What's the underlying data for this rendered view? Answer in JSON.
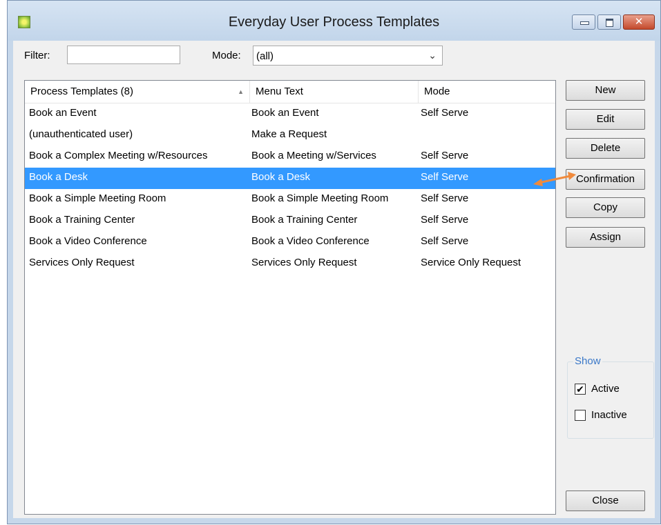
{
  "window": {
    "title": "Everyday User Process Templates"
  },
  "filter": {
    "label": "Filter:",
    "value": ""
  },
  "mode": {
    "label": "Mode:",
    "selected": "(all)"
  },
  "list": {
    "columns": [
      "Process Templates (8)",
      "Menu Text",
      "Mode"
    ],
    "rows": [
      [
        "Book an Event",
        "Book an Event",
        "Self Serve"
      ],
      [
        "(unauthenticated user)",
        "Make a Request",
        ""
      ],
      [
        "Book a Complex Meeting w/Resources",
        "Book a Meeting w/Services",
        "Self Serve"
      ],
      [
        "Book a Desk",
        "Book a Desk",
        "Self Serve"
      ],
      [
        "Book a Simple Meeting Room",
        "Book a Simple Meeting Room",
        "Self Serve"
      ],
      [
        "Book a Training Center",
        "Book a Training Center",
        "Self Serve"
      ],
      [
        "Book a Video Conference",
        "Book a Video Conference",
        "Self Serve"
      ],
      [
        "Services Only Request",
        "Services Only Request",
        "Service Only Request"
      ]
    ],
    "selected_row": 3
  },
  "buttons": {
    "new": "New",
    "edit": "Edit",
    "delete": "Delete",
    "confirmation": "Confirmation",
    "copy": "Copy",
    "assign": "Assign",
    "close": "Close"
  },
  "show": {
    "legend": "Show",
    "active_label": "Active",
    "active_checked": true,
    "inactive_label": "Inactive",
    "inactive_checked": false
  },
  "colors": {
    "selection": "#3399ff",
    "annotation_arrow": "#f08a3c",
    "show_legend": "#3a78c8"
  },
  "icons": {
    "app": "app-icon",
    "minimize": "minimize-icon",
    "maximize": "maximize-icon",
    "close": "close-icon",
    "sort": "sort-ascending-icon",
    "dropdown": "chevron-down-icon",
    "check": "check-icon"
  }
}
